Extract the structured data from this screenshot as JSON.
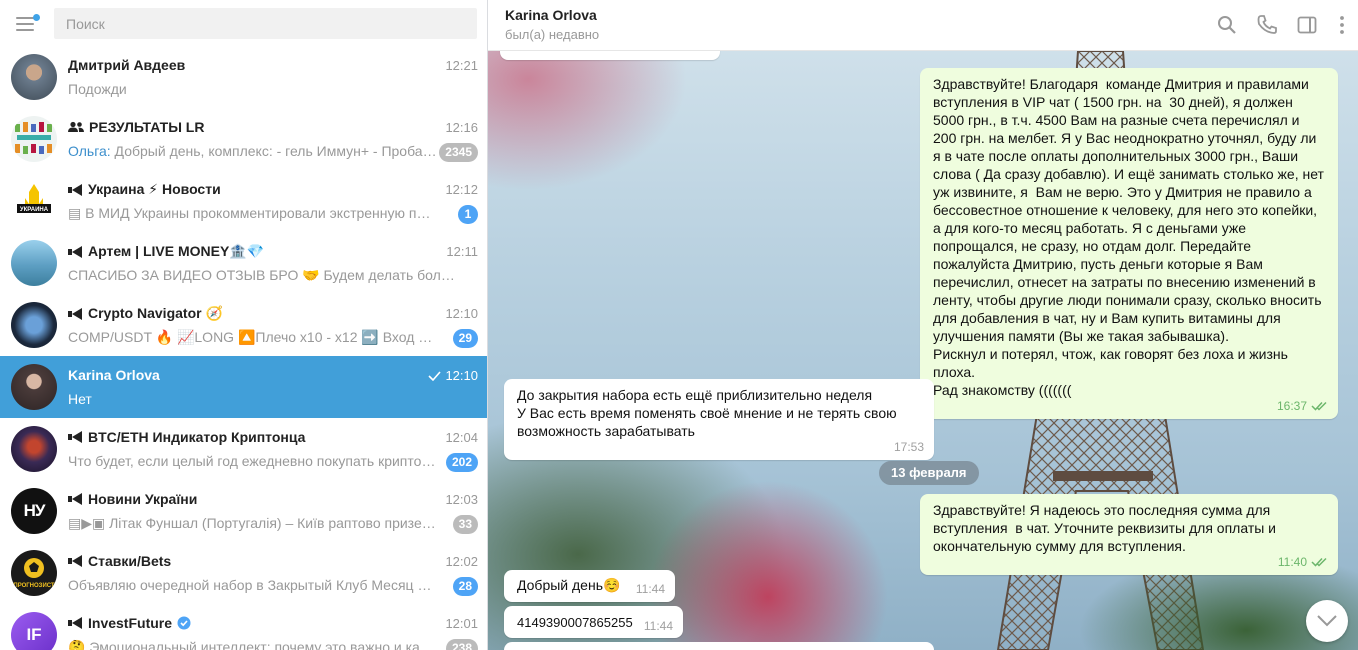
{
  "search": {
    "placeholder": "Поиск"
  },
  "chats": [
    {
      "name": "Дмитрий Авдеев",
      "time": "12:21",
      "preview": "Подожди",
      "type": "user",
      "avatar_color": "#6b7b8c"
    },
    {
      "name": "РЕЗУЛЬТАТЫ LR",
      "time": "12:16",
      "sender": "Ольга:",
      "preview": " Добрый день, комплекс:  - гель Иммун+ - Пробала...",
      "badge": "2345",
      "badge_muted": true,
      "type": "group",
      "avatar_color": "#e8eef0"
    },
    {
      "name": "Украина ⚡ Новости",
      "time": "12:12",
      "preview": "▤ В МИД Украины прокомментировали экстренную посад...",
      "badge": "1",
      "badge_muted": false,
      "type": "channel",
      "avatar_color": "#111111"
    },
    {
      "name": "Артем | LIVE MONEY🏦💎",
      "time": "12:11",
      "preview": "СПАСИБО ЗА ВИДЕО ОТЗЫВ БРО 🤝  Будем делать больше и бо...",
      "type": "channel",
      "avatar_color": "#5d9fc3"
    },
    {
      "name": "Crypto Navigator 🧭",
      "time": "12:10",
      "preview": "COMP/USDT 🔥  📈LONG  🔼Плечо x10 - x12  ➡️ Вход в ра...",
      "badge": "29",
      "badge_muted": false,
      "type": "channel",
      "avatar_color": "#1c2a3e"
    },
    {
      "name": "Karina Orlova",
      "time": "12:10",
      "preview": "Нет",
      "type": "user",
      "active": true,
      "read": true,
      "avatar_color": "#4a3b3a"
    },
    {
      "name": "BTC/ETH Индикатор Криптонца",
      "time": "12:04",
      "preview": "Что будет, если целый год ежедневно покупать криптовал...",
      "badge": "202",
      "badge_muted": false,
      "type": "channel",
      "avatar_color": "#3a2a55"
    },
    {
      "name": "Новини України",
      "time": "12:03",
      "preview": "▤▶▣ Літак Фуншал (Португалія) – Київ раптово призем...",
      "badge": "33",
      "badge_muted": true,
      "type": "channel",
      "avatar_color": "#111111"
    },
    {
      "name": "Ставки/Bets",
      "time": "12:02",
      "preview": "Объявляю очередной набор в Закрытый Клуб  Месяц в сам...",
      "badge": "28",
      "badge_muted": false,
      "type": "channel",
      "avatar_color": "#1a1a1a"
    },
    {
      "name": "InvestFuture",
      "time": "12:01",
      "preview": "🤔 Эмоциональный интеллект: почему это важно и как е...",
      "badge": "238",
      "badge_muted": true,
      "type": "channel",
      "verified": true,
      "avatar_color": "#7b3fd6"
    }
  ],
  "avatar_labels": {
    "ukraine": "УКРАИНА",
    "novyny": "НУ",
    "bets": "ПРОГНОЗИСТ",
    "invest": "IF"
  },
  "header": {
    "name": "Karina Orlova",
    "status": "был(а) недавно"
  },
  "messages": {
    "m1": {
      "text": "Здравствуйте! Благодаря  команде Дмитрия и правилами вступления в VIP чат ( 1500 грн. на  30 дней), я должен 5000 грн., в т.ч. 4500 Вам на разные счета перечислял и 200 грн. на мелбет. Я у Вас неоднократно уточнял, буду ли я в чате после оплаты дополнительных 3000 грн., Ваши слова ( Да сразу добавлю). И ещё занимать столько же, нет уж извините, я  Вам не верю. Это у Дмитрия не правило а бессовестное отношение к человеку, для него это копейки, а для кого-то месяц работать. Я с деньгами уже попрощался, не сразу, но отдам долг. Передайте пожалуйста Дмитрию, пусть деньги которые я Вам перечислил, отнесет на затраты по внесению изменений в ленту, чтобы другие люди понимали сразу, сколько вносить для добавления в чат, ну и Вам купить витамины для улучшения памяти (Вы же такая забывашка).\nРискнул и потерял, чтож, как говорят без лоха и жизнь плоха.\nРад знакомству (((((((",
      "time": "16:37"
    },
    "m2": {
      "text": "До закрытия набора есть ещё приблизительно неделя\nУ Вас есть время поменять своё мнение и не терять свою возможность зарабатывать",
      "time": "17:53"
    },
    "date": "13 февраля",
    "m3": {
      "text": "Здравствуйте! Я надеюсь это последняя сумма для вступления  в чат. Уточните реквизиты для оплаты и окончательную сумму для вступления.",
      "time": "11:40"
    },
    "m4": {
      "text": "Добрый день☺️",
      "time": "11:44"
    },
    "m5": {
      "text": "4149390007865255",
      "time": "11:44"
    }
  },
  "colors": {
    "accent": "#419fd9",
    "badge": "#4ea4f6",
    "badge_muted": "#bbbbbb",
    "outgoing_bubble": "#effdde",
    "read_check": "#6cb66b"
  }
}
